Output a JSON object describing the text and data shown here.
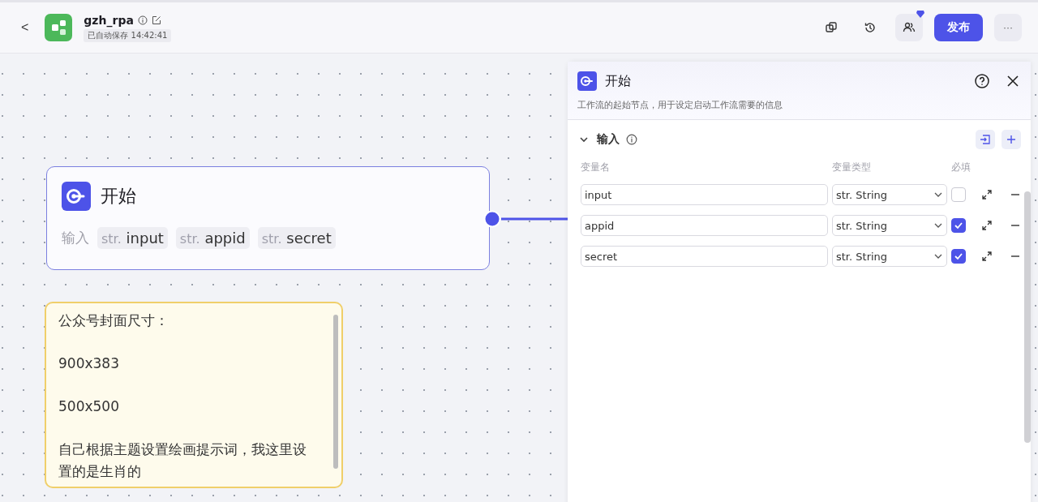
{
  "header": {
    "back": "<",
    "title": "gzh_rpa",
    "autosave": "已自动保存 14:42:41",
    "publish": "发布",
    "more": "···"
  },
  "start_node": {
    "title": "开始",
    "inputs_label": "输入",
    "inputs": [
      {
        "type": "str.",
        "name": "input"
      },
      {
        "type": "str.",
        "name": "appid"
      },
      {
        "type": "str.",
        "name": "secret"
      }
    ]
  },
  "note": {
    "paragraphs": [
      "公众号封面尺寸：",
      "900x383",
      "500x500",
      "自己根据主题设置绘画提示词，我这里设置的是生肖的"
    ]
  },
  "panel": {
    "title": "开始",
    "description": "工作流的起始节点，用于设定启动工作流需要的信息",
    "section": {
      "title": "输入",
      "expanded": true
    },
    "columns": [
      "变量名",
      "变量类型",
      "必填"
    ],
    "rows": [
      {
        "name": "input",
        "type": "str. String",
        "required": false
      },
      {
        "name": "appid",
        "type": "str. String",
        "required": true
      },
      {
        "name": "secret",
        "type": "str. String",
        "required": true
      }
    ]
  }
}
